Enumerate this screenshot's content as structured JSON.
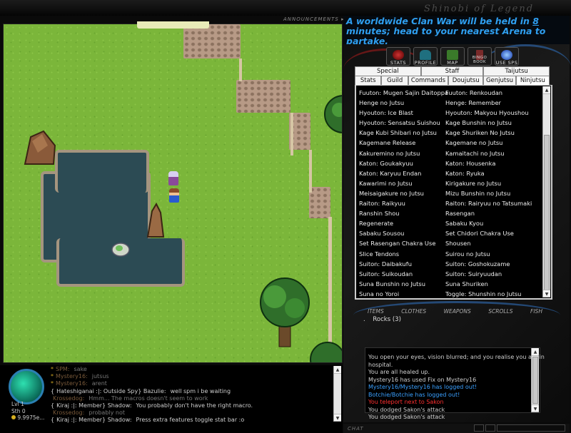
{
  "header": {
    "game_title": "Shinobi of Legend",
    "announcements_label": "ANNOUNCEMENTS ▸▸",
    "broadcast_pre": "A worldwide Clan War will be held in ",
    "broadcast_minutes": "8",
    "broadcast_post": " minutes; head to your nearest Arena to partake."
  },
  "menu": [
    {
      "label": "STATS",
      "icon": "stats-icon"
    },
    {
      "label": "PROFILE",
      "icon": "profile-icon"
    },
    {
      "label": "MAP",
      "icon": "map-icon"
    },
    {
      "label": "BINGO BOOK",
      "icon": "bingo-book-icon"
    },
    {
      "label": "USE SPS",
      "icon": "use-sps-icon"
    }
  ],
  "tabs_top": [
    "Special",
    "Staff",
    "Taijutsu"
  ],
  "tabs_bottom": [
    "Stats",
    "Guild",
    "Commands",
    "Doujutsu",
    "Genjutsu",
    "Ninjutsu"
  ],
  "active_tab": "Ninjutsu",
  "jutsu_left": [
    "Fuuton: Mugen Sajin Daitoppa",
    "Henge no Jutsu",
    "Hyouton: Ice Blast",
    "Hyouton: Sensatsu Suishou",
    "Kage Kubi Shibari no Jutsu",
    "Kagemane Release",
    "Kakuremino no Jutsu",
    "Katon: Goukakyuu",
    "Katon: Karyuu Endan",
    "Kawarimi no Jutsu",
    "Meisaigakure no Jutsu",
    "Raiton: Raikyuu",
    "Ranshin Shou",
    "Regenerate",
    "Sabaku Sousou",
    "Set Rasengan Chakra Use",
    "Slice Tendons",
    "Suiton: Daibakufu",
    "Suiton: Suikoudan",
    "Suna Bunshin no Jutsu",
    "Suna no Yoroi"
  ],
  "jutsu_right": [
    "Fuuton: Renkoudan",
    "Henge: Remember",
    "Hyouton: Makyou Hyoushou",
    "Kage Bunshin no Jutsu",
    "Kage Shuriken No Jutsu",
    "Kagemane no Jutsu",
    "Kamaitachi no Jutsu",
    "Katon: Housenka",
    "Katon: Ryuka",
    "Kirigakure no Jutsu",
    "Mizu Bunshin no Jutsu",
    "Raiton: Rairyuu no Tatsumaki",
    "Rasengan",
    "Sabaku Kyou",
    "Set Chidori Chakra Use",
    "Shousen",
    "Suirou no Jutsu",
    "Suiton: Goshokuzame",
    "Suiton: Suiryuudan",
    "Suna Shuriken",
    "Toggle: Shunshin no Jutsu"
  ],
  "inventory_tabs": [
    "ITEMS",
    "CLOTHES",
    "WEAPONS",
    "SCROLLS",
    "FISH"
  ],
  "inventory": {
    "bullet": ".",
    "item": "Rocks (3)"
  },
  "log": [
    {
      "text": "You open your eyes, vision blurred; and you realise you are in",
      "color": "#cfcfcf"
    },
    {
      "text": "hospital.",
      "color": "#cfcfcf"
    },
    {
      "text": "You are all healed up.",
      "color": "#cfcfcf"
    },
    {
      "text": "Mystery16 has used Fix on Mystery16",
      "color": "#cfcfcf"
    },
    {
      "text": "Mystery16/Mystery16 has logged out!",
      "color": "#3aa0ff"
    },
    {
      "text": "Botchie/Botchie has logged out!",
      "color": "#3aa0ff"
    },
    {
      "text": "You teleport next to Sakon",
      "color": "#ff3030"
    },
    {
      "text": "You dodged Sakon's attack",
      "color": "#cfcfcf"
    },
    {
      "text": "You dodged Sakon's attack",
      "color": "#cfcfcf"
    }
  ],
  "chat": [
    {
      "prefix": "*",
      "name": "SPM:",
      "msg": "sake",
      "name_color": "#7a5a3a",
      "msg_color": "#777"
    },
    {
      "prefix": "*",
      "name": "Mystery16:",
      "msg": "jutsus",
      "name_color": "#7a5a3a",
      "msg_color": "#777"
    },
    {
      "prefix": "*",
      "name": "Mystery16:",
      "msg": "arent",
      "name_color": "#7a5a3a",
      "msg_color": "#777"
    },
    {
      "prefix": "{",
      "name": "Hateshiganai :|: Outside Spy} Bazulie:",
      "msg": "well spm i be waiting",
      "name_color": "#cfcfcf",
      "msg_color": "#cfcfcf"
    },
    {
      "prefix": "",
      "name": "Krossedog:",
      "msg": "Hmm... The macros doesn't seem to work",
      "name_color": "#7a5a3a",
      "msg_color": "#777"
    },
    {
      "prefix": "{",
      "name": "Kiraj :|: Member} Shadow:",
      "msg": "You probably don't have the right macro.",
      "name_color": "#cfcfcf",
      "msg_color": "#cfcfcf"
    },
    {
      "prefix": "",
      "name": "Krossedog:",
      "msg": "probably not",
      "name_color": "#7a5a3a",
      "msg_color": "#777"
    },
    {
      "prefix": "{",
      "name": "Kiraj :|: Member} Shadow:",
      "msg": "Press extra features toggle stat bar :o",
      "name_color": "#cfcfcf",
      "msg_color": "#cfcfcf"
    }
  ],
  "player_stats": {
    "lvl_label": "Lvl",
    "lvl": "1",
    "stat_label": "Sth",
    "stat": "0",
    "money": "9.9975e..."
  },
  "chat_label": "CHAT"
}
